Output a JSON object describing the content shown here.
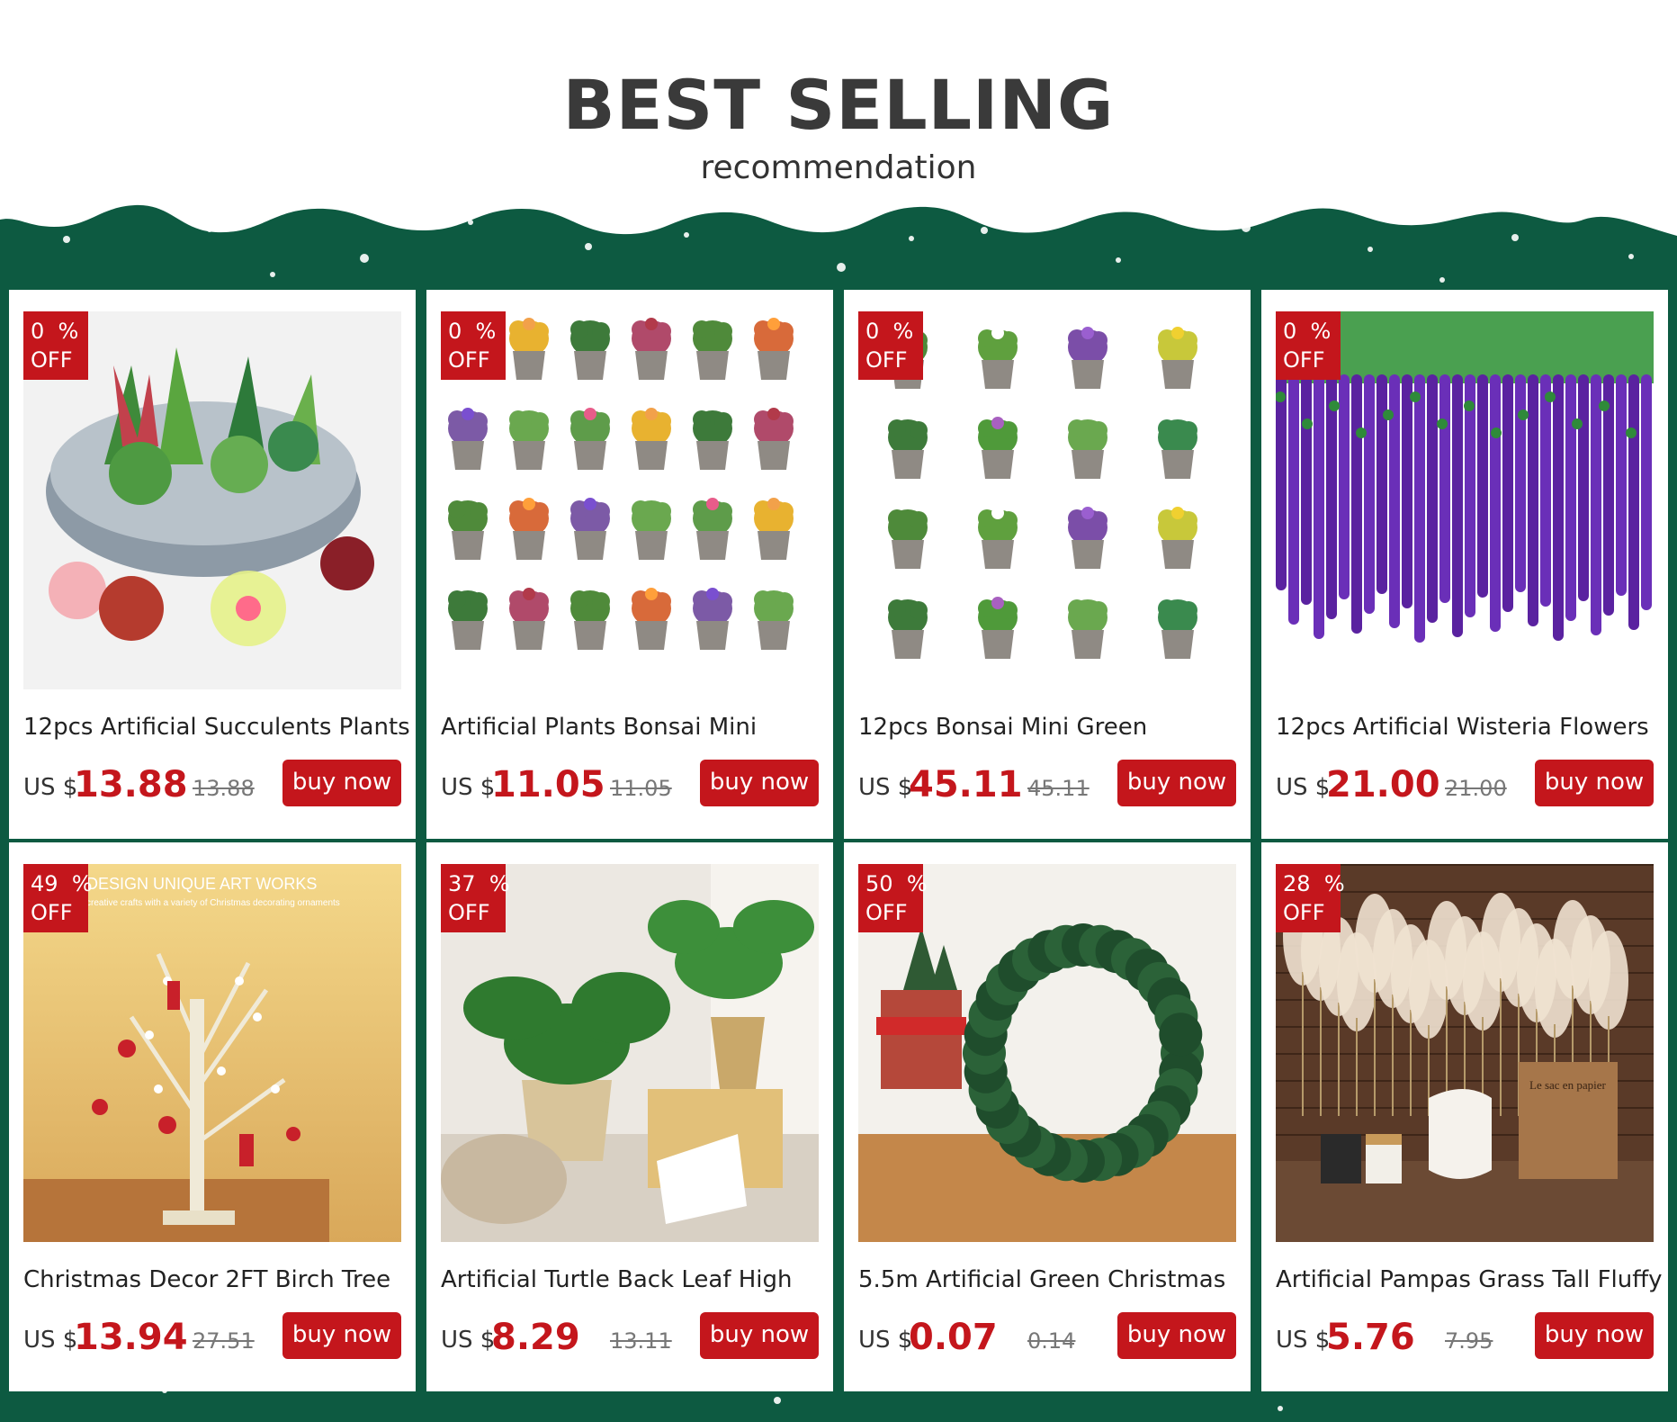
{
  "header": {
    "title": "BEST SELLING",
    "subtitle": "recommendation"
  },
  "labels": {
    "currency": "US $",
    "buy": "buy now",
    "off": "OFF",
    "pct_suffix": "%"
  },
  "products": [
    {
      "name": "12pcs Artificial Succulents Plants",
      "discount": "0",
      "price": "13.88",
      "old_price": "13.88",
      "image": "succulents-bowl"
    },
    {
      "name": "Artificial Plants Bonsai Mini",
      "discount": "0",
      "price": "11.05",
      "old_price": "11.05",
      "image": "mini-potted-plants"
    },
    {
      "name": "12pcs Bonsai Mini Green",
      "discount": "0",
      "price": "45.11",
      "old_price": "45.11",
      "image": "bonsai-pots-grid"
    },
    {
      "name": "12pcs Artificial Wisteria Flowers",
      "discount": "0",
      "price": "21.00",
      "old_price": "21.00",
      "image": "purple-wisteria"
    },
    {
      "name": "Christmas Decor 2FT Birch Tree",
      "discount": "49",
      "price": "13.94",
      "old_price": "27.51",
      "image": "birch-tree-lights",
      "image_text": [
        "DESIGN UNIQUE ART WORKS",
        "creative crafts with a variety of Christmas decorating ornaments"
      ]
    },
    {
      "name": "Artificial Turtle Back Leaf High",
      "discount": "37",
      "price": "8.29",
      "old_price": "13.11",
      "image": "monstera-baskets"
    },
    {
      "name": "5.5m Artificial Green Christmas",
      "discount": "50",
      "price": "0.07",
      "old_price": "0.14",
      "image": "pine-garland-wreath"
    },
    {
      "name": "Artificial Pampas Grass Tall Fluffy",
      "discount": "28",
      "price": "5.76",
      "old_price": "7.95",
      "image": "pampas-grass-vase",
      "image_text": [
        "Le sac en papier"
      ]
    }
  ],
  "colors": {
    "accent": "#c4161c",
    "background": "#0d5a41",
    "title": "#3a3a3a"
  }
}
